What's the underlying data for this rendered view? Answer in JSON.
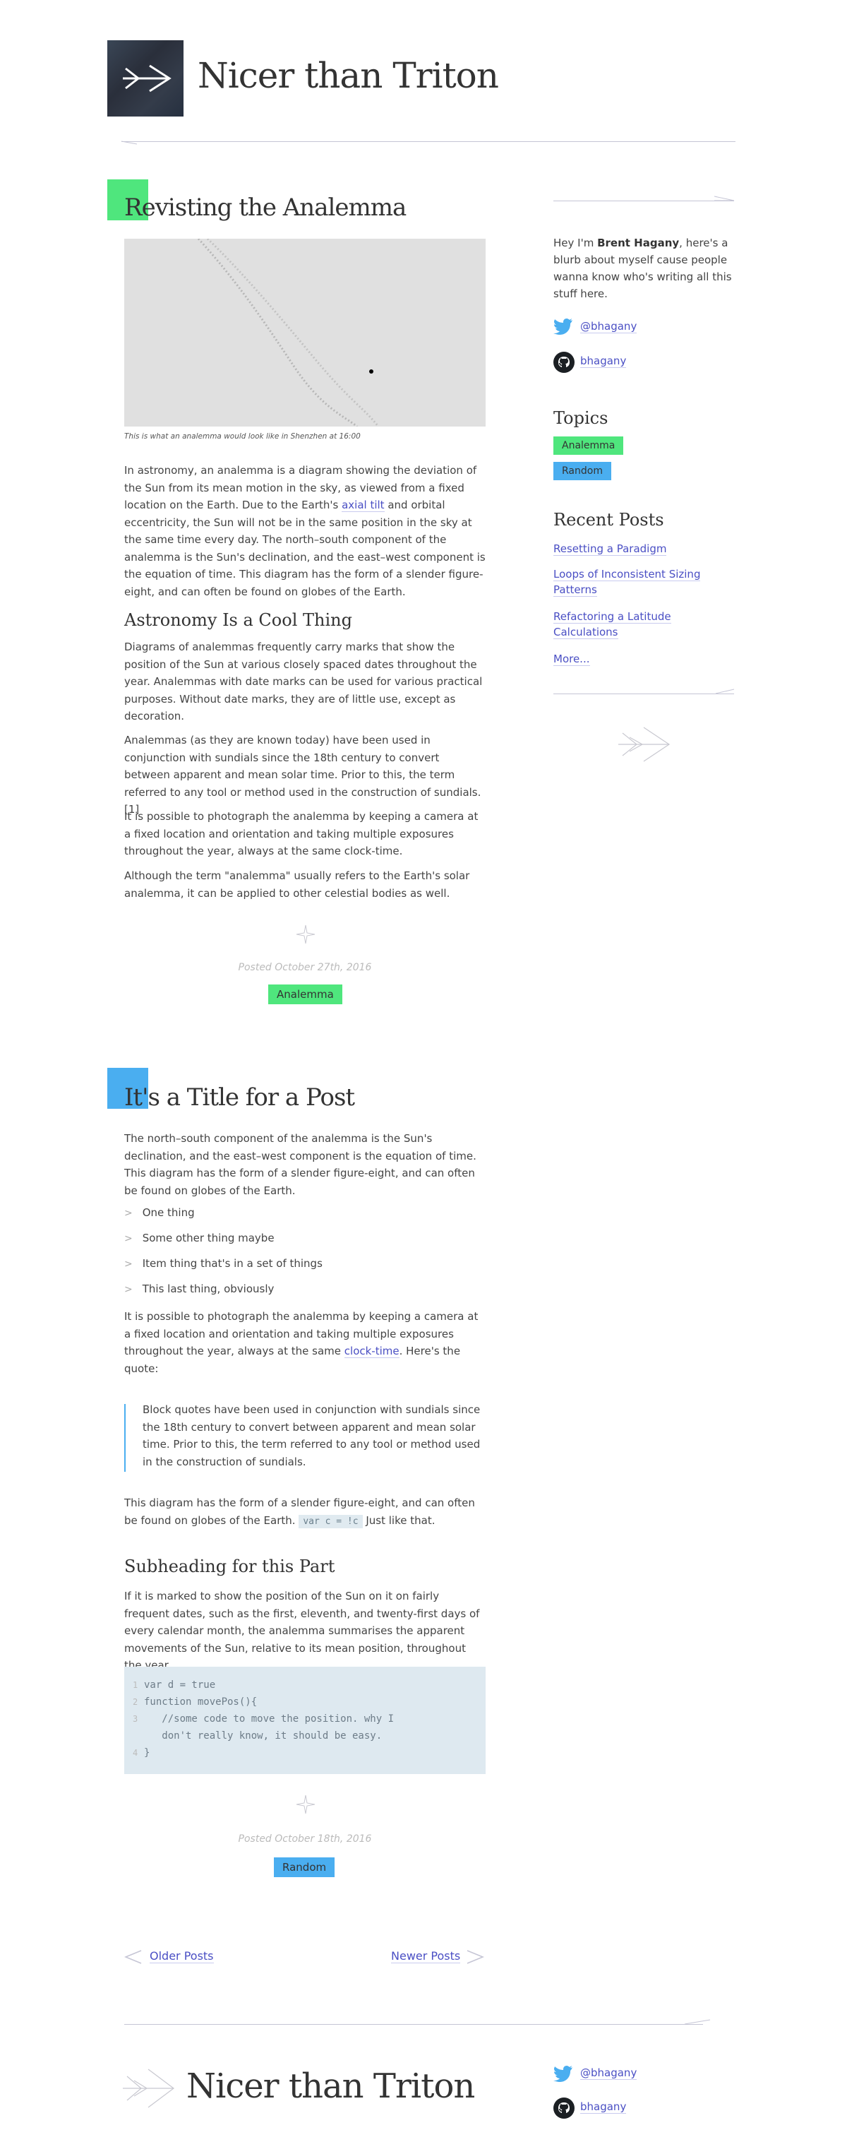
{
  "site": {
    "title": "Nicer than Triton"
  },
  "colors": {
    "green": "#4fe67d",
    "blue": "#4aaef0",
    "link": "#4a4fc4"
  },
  "post1": {
    "title": "Revisting the Analemma",
    "caption": "This is what an analemma would look like in Shenzhen at 16:00",
    "p1_a": "In astronomy, an analemma is a diagram showing the deviation of the Sun from its mean motion in the sky, as viewed from a fixed location on the Earth. Due to the Earth's ",
    "p1_link": "axial tilt",
    "p1_b": " and orbital eccentricity, the Sun will not be in the same position in the sky at the same time every day. The north–south component of the analemma is the Sun's declination, and the east–west component is the equation of time. This diagram has the form of a slender figure-eight, and can often be found on globes of the Earth.",
    "subheading": "Astronomy Is a Cool Thing",
    "p2": "Diagrams of analemmas frequently carry marks that show the position of the Sun at various closely spaced dates throughout the year. Analemmas with date marks can be used for various practical purposes. Without date marks, they are of little use, except as decoration.",
    "p3": "Analemmas (as they are known today) have been used in conjunction with sundials since the 18th century to convert between apparent and mean solar time. Prior to this, the term referred to any tool or method used in the construction of sundials.[1]",
    "p4": "It is possible to photograph the analemma by keeping a camera at a fixed location and orientation and taking multiple exposures throughout the year, always at the same clock-time.",
    "p5": "Although the term \"analemma\" usually refers to the Earth's solar analemma, it can be applied to other celestial bodies as well.",
    "posted": "Posted October 27th, 2016",
    "tag": "Analemma"
  },
  "post2": {
    "title": "It's a Title for a Post",
    "p1": "The north–south component of the analemma is the Sun's declination, and the east–west component is the equation of time. This diagram has the form of a slender figure-eight, and can often be found on globes of the Earth.",
    "list": [
      "One thing",
      "Some other thing maybe",
      "Item thing that's in a set of things",
      "This last thing, obviously"
    ],
    "p2_a": "It is possible to photograph the analemma by keeping a camera at a fixed location and orientation and taking multiple exposures throughout the year, always at the same ",
    "p2_link": "clock-time",
    "p2_b": ". Here's the quote:",
    "quote": "Block quotes have been used in conjunction with sundials since the 18th century to convert between apparent and mean solar time. Prior to this, the term referred to any tool or method used in the construction of sundials.",
    "p3_a": "This diagram has the form of a slender figure-eight, and can often be found on globes of the Earth. ",
    "p3_code": "var c = !c",
    "p3_b": " Just like that.",
    "subheading": "Subheading for this Part",
    "p4": "If it is marked to show the position of the Sun on it on fairly frequent dates, such as the first, eleventh, and twenty-first days of every calendar month, the analemma summarises the apparent movements of the Sun, relative to its mean position, throughout the year.",
    "code": [
      {
        "num": "1",
        "text": "var d = true"
      },
      {
        "num": "2",
        "text": "function movePos(){"
      },
      {
        "num": "3",
        "text": "   //some code to move the position. why I"
      },
      {
        "num": "",
        "text": "   don't really know, it should be easy."
      },
      {
        "num": "4",
        "text": "}"
      }
    ],
    "posted": "Posted October 18th, 2016",
    "tag": "Random"
  },
  "nav": {
    "older": "Older Posts",
    "newer": "Newer Posts"
  },
  "sidebar": {
    "intro_a": "Hey I'm ",
    "intro_name": "Brent Hagany",
    "intro_b": ", here's a blurb about myself cause people wanna know who's writing all this stuff here.",
    "twitter": "@bhagany",
    "github": "bhagany",
    "topics_heading": "Topics",
    "topics": [
      "Analemma",
      "Random"
    ],
    "recent_heading": "Recent Posts",
    "recent": [
      "Resetting a Paradigm",
      "Loops of Inconsistent Sizing Patterns",
      "Refactoring a Latitude Calculations"
    ],
    "more": "More..."
  },
  "footer": {
    "title": "Nicer than Triton",
    "twitter": "@bhagany",
    "github": "bhagany"
  }
}
